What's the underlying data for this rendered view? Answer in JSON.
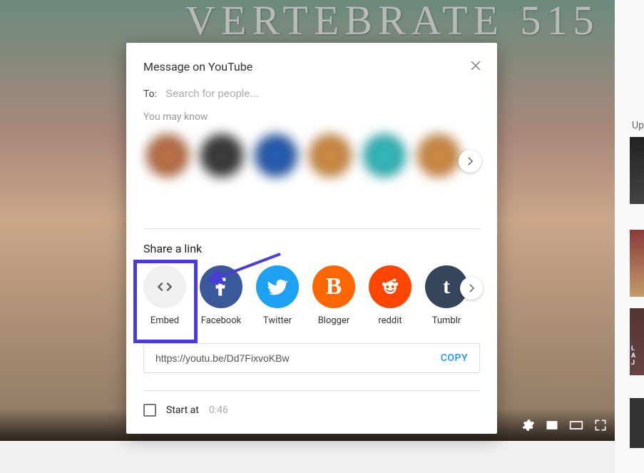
{
  "video": {
    "title_bg": "VERTEBRATE 515"
  },
  "sidebar": {
    "upnext": "Up"
  },
  "modal": {
    "title": "Message on YouTube",
    "to_label": "To:",
    "to_placeholder": "Search for people...",
    "youmayknow": "You may know",
    "share_label": "Share a link",
    "share_items": {
      "embed": "Embed",
      "facebook": "Facebook",
      "twitter": "Twitter",
      "blogger": "Blogger",
      "reddit": "reddit",
      "tumblr": "Tumblr"
    },
    "url": "https://youtu.be/Dd7FixvoKBw",
    "copy": "COPY",
    "startat_label": "Start at",
    "startat_time": "0:46"
  }
}
